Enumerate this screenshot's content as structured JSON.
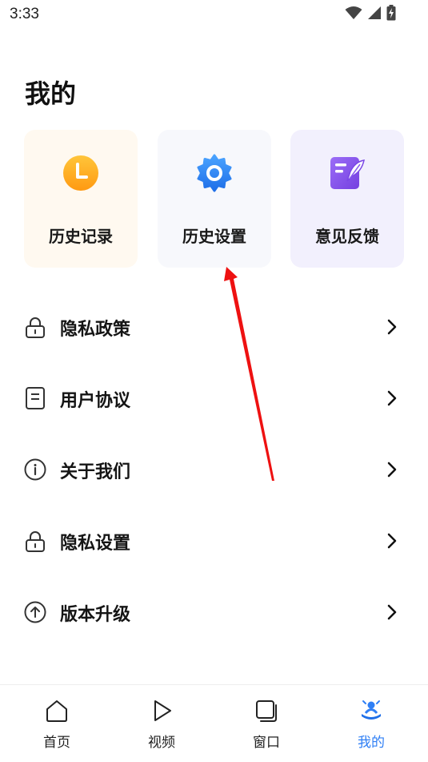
{
  "status_bar": {
    "time": "3:33"
  },
  "page": {
    "title": "我的"
  },
  "cards": [
    {
      "label": "历史记录",
      "icon": "clock-icon",
      "color": "#ffa41a"
    },
    {
      "label": "历史设置",
      "icon": "gear-icon",
      "color": "#2f7ff5"
    },
    {
      "label": "意见反馈",
      "icon": "feedback-note-icon",
      "color": "#8a5cf0"
    }
  ],
  "menu": [
    {
      "label": "隐私政策",
      "icon": "lock-icon"
    },
    {
      "label": "用户协议",
      "icon": "document-icon"
    },
    {
      "label": "关于我们",
      "icon": "info-icon"
    },
    {
      "label": "隐私设置",
      "icon": "lock-icon"
    },
    {
      "label": "版本升级",
      "icon": "upgrade-icon"
    }
  ],
  "tabbar": {
    "active_color": "#2f7ff5",
    "tabs": [
      {
        "label": "首页",
        "icon": "home-icon"
      },
      {
        "label": "视频",
        "icon": "play-icon"
      },
      {
        "label": "窗口",
        "icon": "window-icon"
      },
      {
        "label": "我的",
        "icon": "profile-icon",
        "active": true
      }
    ]
  }
}
